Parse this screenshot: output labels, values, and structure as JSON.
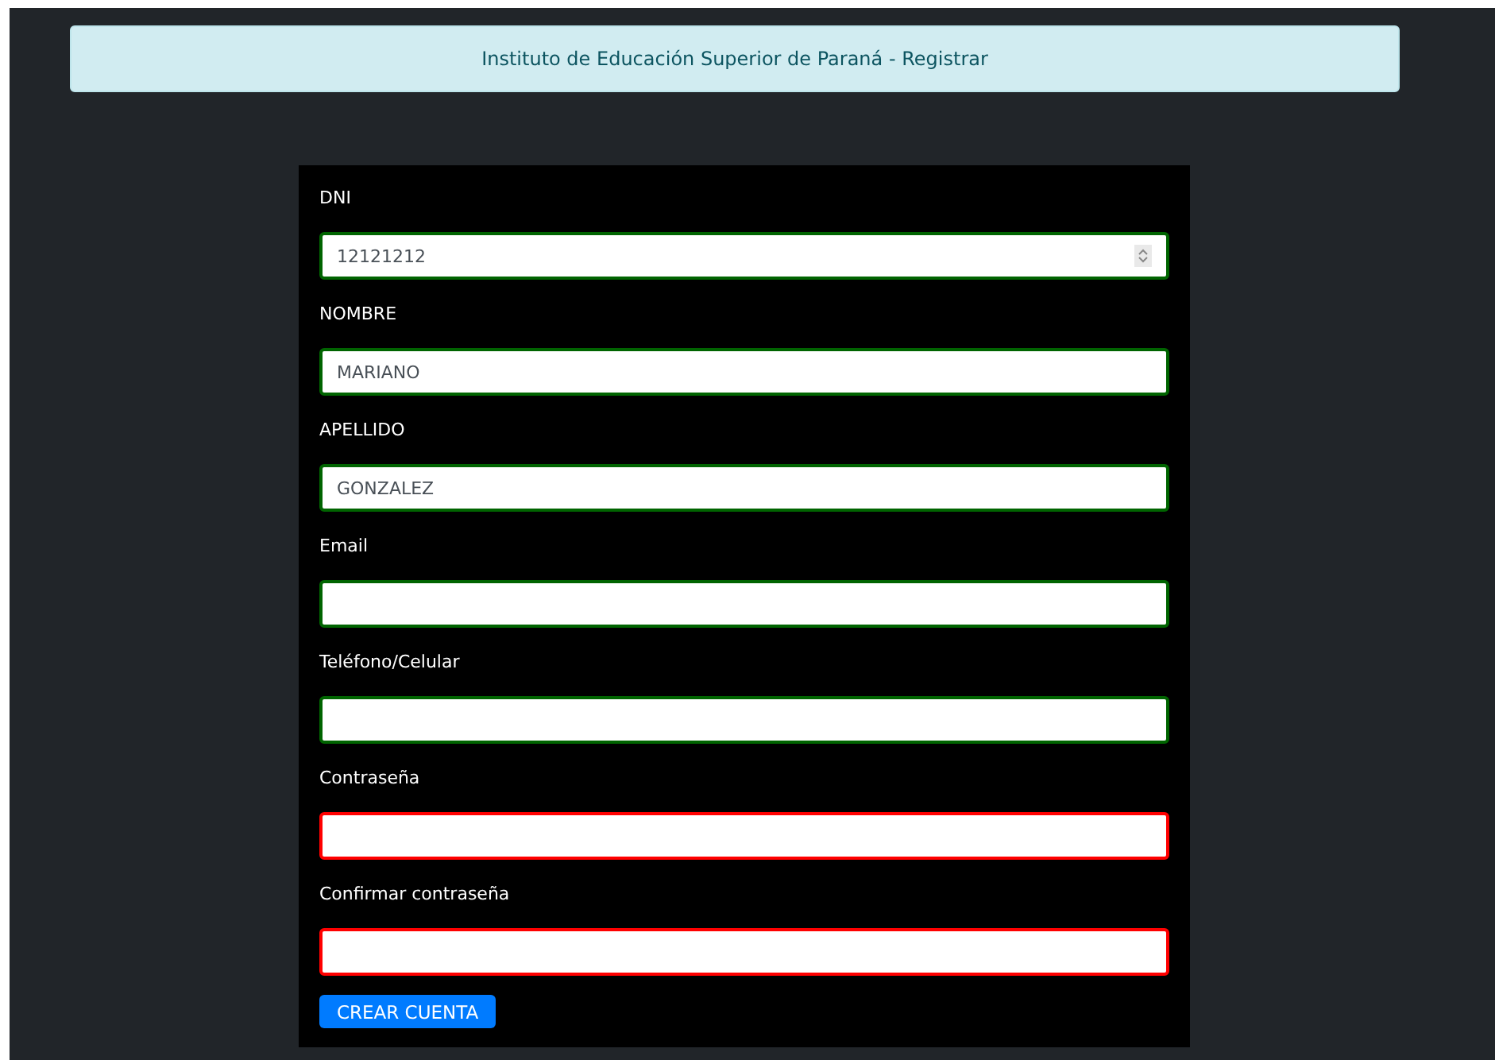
{
  "header": {
    "title": "Instituto de Educación Superior de Paraná - Registrar"
  },
  "fields": [
    {
      "label": "DNI",
      "kind": "number",
      "value": "12121212",
      "invalid": false
    },
    {
      "label": "NOMBRE",
      "kind": "text",
      "value": "MARIANO",
      "invalid": false
    },
    {
      "label": "APELLIDO",
      "kind": "text",
      "value": "GONZALEZ",
      "invalid": false
    },
    {
      "label": "Email",
      "kind": "text",
      "invalid": false
    },
    {
      "label": "Teléfono/Celular",
      "kind": "text",
      "invalid": false
    },
    {
      "label": "Contraseña",
      "kind": "password",
      "invalid": true
    },
    {
      "label": "Confirmar contraseña",
      "kind": "password",
      "invalid": true
    }
  ],
  "submit": {
    "label": "CREAR CUENTA"
  }
}
